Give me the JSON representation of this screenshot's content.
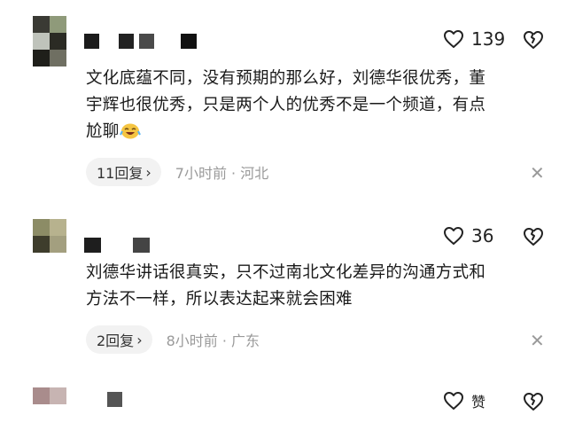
{
  "comments": [
    {
      "likes": "139",
      "text_line1": "文化底蕴不同，没有预期的那么好，刘德华很优秀，董",
      "text_line2": "宇辉也很优秀，只是两个人的优秀不是一个频道，有点",
      "text_line3": "尬聊",
      "emoji": "laughing-crying-emoji",
      "reply_label": "11回复",
      "meta": "7小时前 · 河北"
    },
    {
      "likes": "36",
      "text_line1": "刘德华讲话很真实，只不过南北文化差异的沟通方式和",
      "text_line2": "方法不一样，所以表达起来就会困难",
      "reply_label": "2回复",
      "meta": "8小时前 · 广东"
    },
    {
      "likes": "赞"
    }
  ],
  "icons": {
    "like": "heart-outline-icon",
    "dislike": "broken-heart-icon",
    "reply_chevron": "chevron-right-icon",
    "close": "close-icon"
  }
}
